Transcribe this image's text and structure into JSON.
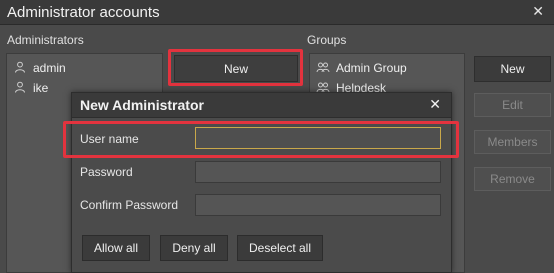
{
  "window": {
    "title": "Administrator accounts",
    "close_glyph": "✕"
  },
  "administrators": {
    "label": "Administrators",
    "items": [
      {
        "name": "admin",
        "icon": "user-icon"
      },
      {
        "name": "ike",
        "icon": "user-icon"
      }
    ],
    "new_button": "New"
  },
  "groups": {
    "label": "Groups",
    "items": [
      {
        "name": "Admin Group",
        "icon": "group-icon"
      },
      {
        "name": "Helpdesk",
        "icon": "group-icon"
      }
    ]
  },
  "group_buttons": {
    "new": "New",
    "edit": "Edit",
    "members": "Members",
    "remove": "Remove"
  },
  "dialog": {
    "title": "New Administrator",
    "close_glyph": "✕",
    "fields": {
      "user_name": {
        "label": "User name",
        "value": ""
      },
      "password": {
        "label": "Password",
        "value": ""
      },
      "confirm_password": {
        "label": "Confirm Password",
        "value": ""
      }
    },
    "buttons": {
      "allow_all": "Allow all",
      "deny_all": "Deny all",
      "deselect_all": "Deselect all"
    }
  },
  "colors": {
    "highlight": "#e3333e",
    "active_field_border": "#c9a84a"
  }
}
